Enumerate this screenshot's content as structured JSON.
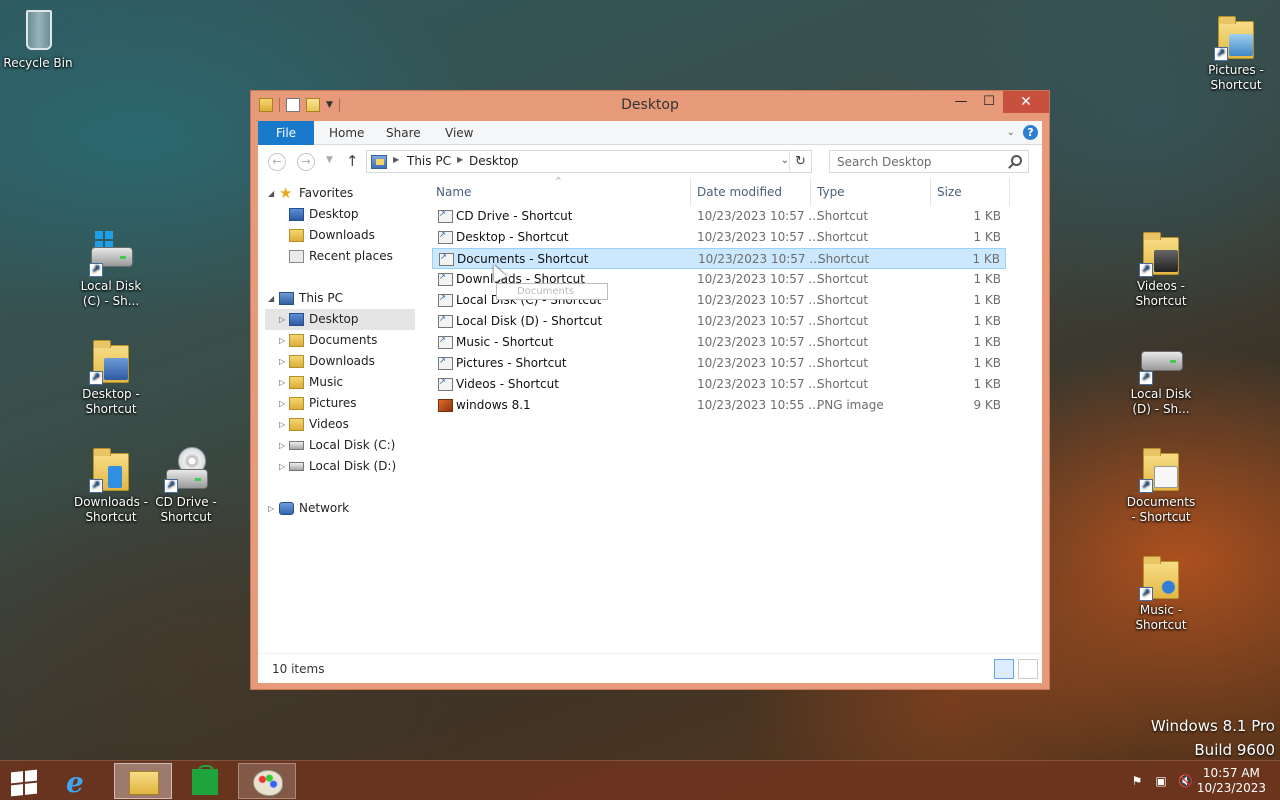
{
  "desktop": {
    "icons": [
      {
        "label": "Recycle Bin"
      },
      {
        "label": "Local Disk (C) - Sh..."
      },
      {
        "label": "Desktop - Shortcut"
      },
      {
        "label": "Downloads - Shortcut"
      },
      {
        "label": "CD Drive - Shortcut"
      },
      {
        "label": "Pictures - Shortcut"
      },
      {
        "label": "Videos - Shortcut"
      },
      {
        "label": "Local Disk (D) - Sh..."
      },
      {
        "label": "Documents - Shortcut"
      },
      {
        "label": "Music - Shortcut"
      }
    ],
    "watermark": {
      "line1": "Windows 8.1 Pro",
      "line2": "Build 9600"
    }
  },
  "window": {
    "title": "Desktop",
    "ribbon_tabs": [
      "File",
      "Home",
      "Share",
      "View"
    ],
    "address": {
      "crumbs": [
        "This PC",
        "Desktop"
      ]
    },
    "search": {
      "placeholder": "Search Desktop"
    },
    "nav": {
      "favorites": "Favorites",
      "fav_items": [
        "Desktop",
        "Downloads",
        "Recent places"
      ],
      "this_pc": "This PC",
      "pc_items": [
        "Desktop",
        "Documents",
        "Downloads",
        "Music",
        "Pictures",
        "Videos",
        "Local Disk (C:)",
        "Local Disk (D:)"
      ],
      "network": "Network"
    },
    "columns": {
      "name": "Name",
      "date": "Date modified",
      "type": "Type",
      "size": "Size"
    },
    "files": [
      {
        "name": "CD Drive - Shortcut",
        "date": "10/23/2023 10:57 ...",
        "type": "Shortcut",
        "size": "1 KB"
      },
      {
        "name": "Desktop - Shortcut",
        "date": "10/23/2023 10:57 ...",
        "type": "Shortcut",
        "size": "1 KB"
      },
      {
        "name": "Documents - Shortcut",
        "date": "10/23/2023 10:57 ...",
        "type": "Shortcut",
        "size": "1 KB"
      },
      {
        "name": "Downloads - Shortcut",
        "date": "10/23/2023 10:57 ...",
        "type": "Shortcut",
        "size": "1 KB"
      },
      {
        "name": "Local Disk (C) - Shortcut",
        "date": "10/23/2023 10:57 ...",
        "type": "Shortcut",
        "size": "1 KB"
      },
      {
        "name": "Local Disk (D) - Shortcut",
        "date": "10/23/2023 10:57 ...",
        "type": "Shortcut",
        "size": "1 KB"
      },
      {
        "name": "Music - Shortcut",
        "date": "10/23/2023 10:57 ...",
        "type": "Shortcut",
        "size": "1 KB"
      },
      {
        "name": "Pictures - Shortcut",
        "date": "10/23/2023 10:57 ...",
        "type": "Shortcut",
        "size": "1 KB"
      },
      {
        "name": "Videos - Shortcut",
        "date": "10/23/2023 10:57 ...",
        "type": "Shortcut",
        "size": "1 KB"
      },
      {
        "name": "windows 8.1",
        "date": "10/23/2023 10:55 ...",
        "type": "PNG image",
        "size": "9 KB"
      }
    ],
    "selected_file": "Documents - Shortcut",
    "tooltip": "Documents",
    "status": "10 items"
  },
  "taskbar": {
    "apps": [
      "start-icon",
      "internet-explorer-icon",
      "file-explorer-icon",
      "store-icon",
      "paint-icon"
    ],
    "clock": {
      "time": "10:57 AM",
      "date": "10/23/2023"
    }
  },
  "colors": {
    "titlebar": "#e69a7a",
    "file_tab": "#1979ca",
    "selection": "#cce8ff",
    "close": "#c7503f"
  }
}
